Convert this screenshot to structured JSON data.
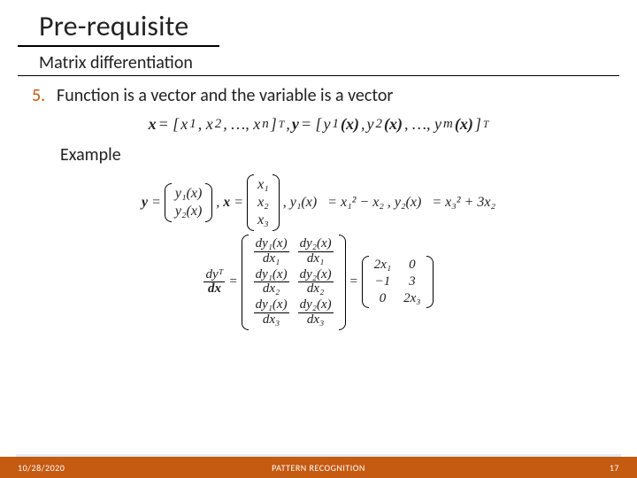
{
  "title": "Pre-requisite",
  "subtitle": "Matrix differentiation",
  "list": {
    "num": "5.",
    "text": "Function is a vector and the variable is a vector"
  },
  "defs": {
    "x_lhs": "x",
    "x_eq": " = [",
    "x_items": "x",
    "x_sub1": "1",
    "x_sep": ", x",
    "x_sub2": "2",
    "x_dots": ", …, x",
    "x_subn": "n",
    "x_close": "]",
    "tsup": "T",
    "comma": " , ",
    "y_lhs": "y",
    "y_eq": " = [",
    "y_items": "y",
    "paren_x": "(x)",
    "y_dots": ", …, y",
    "y_subm": "m"
  },
  "example_label": "Example",
  "ex": {
    "y": "y",
    "eq": "=",
    "y1x": "y₁(x)",
    "y2x": "y₂(x)",
    "x": "x",
    "x1": "x₁",
    "x2": "x₂",
    "x3": "x₃",
    "comma": ",",
    "y1def_lhs": "y₁(x)",
    "y1def_rhs": "= x₁² − x₂",
    "y2def_lhs": "y₂(x)",
    "y2def_rhs": "= x₃² + 3x₂"
  },
  "jac": {
    "lhs_num": "dyᵀ",
    "lhs_den": "dx",
    "eq": "=",
    "cells": {
      "a": {
        "num": "dy₁(x)",
        "den": "dx₁"
      },
      "b": {
        "num": "dy₂(x)",
        "den": "dx₁"
      },
      "c": {
        "num": "dy₁(x)",
        "den": "dx₂"
      },
      "d": {
        "num": "dy₂(x)",
        "den": "dx₂"
      },
      "e": {
        "num": "dy₁(x)",
        "den": "dx₃"
      },
      "f": {
        "num": "dy₂(x)",
        "den": "dx₃"
      }
    },
    "result": {
      "r11": "2x₁",
      "r12": "0",
      "r21": "−1",
      "r22": "3",
      "r31": "0",
      "r32": "2x₃"
    }
  },
  "footer": {
    "date": "10/28/2020",
    "course": "PATTERN RECOGNITION",
    "page": "17"
  }
}
